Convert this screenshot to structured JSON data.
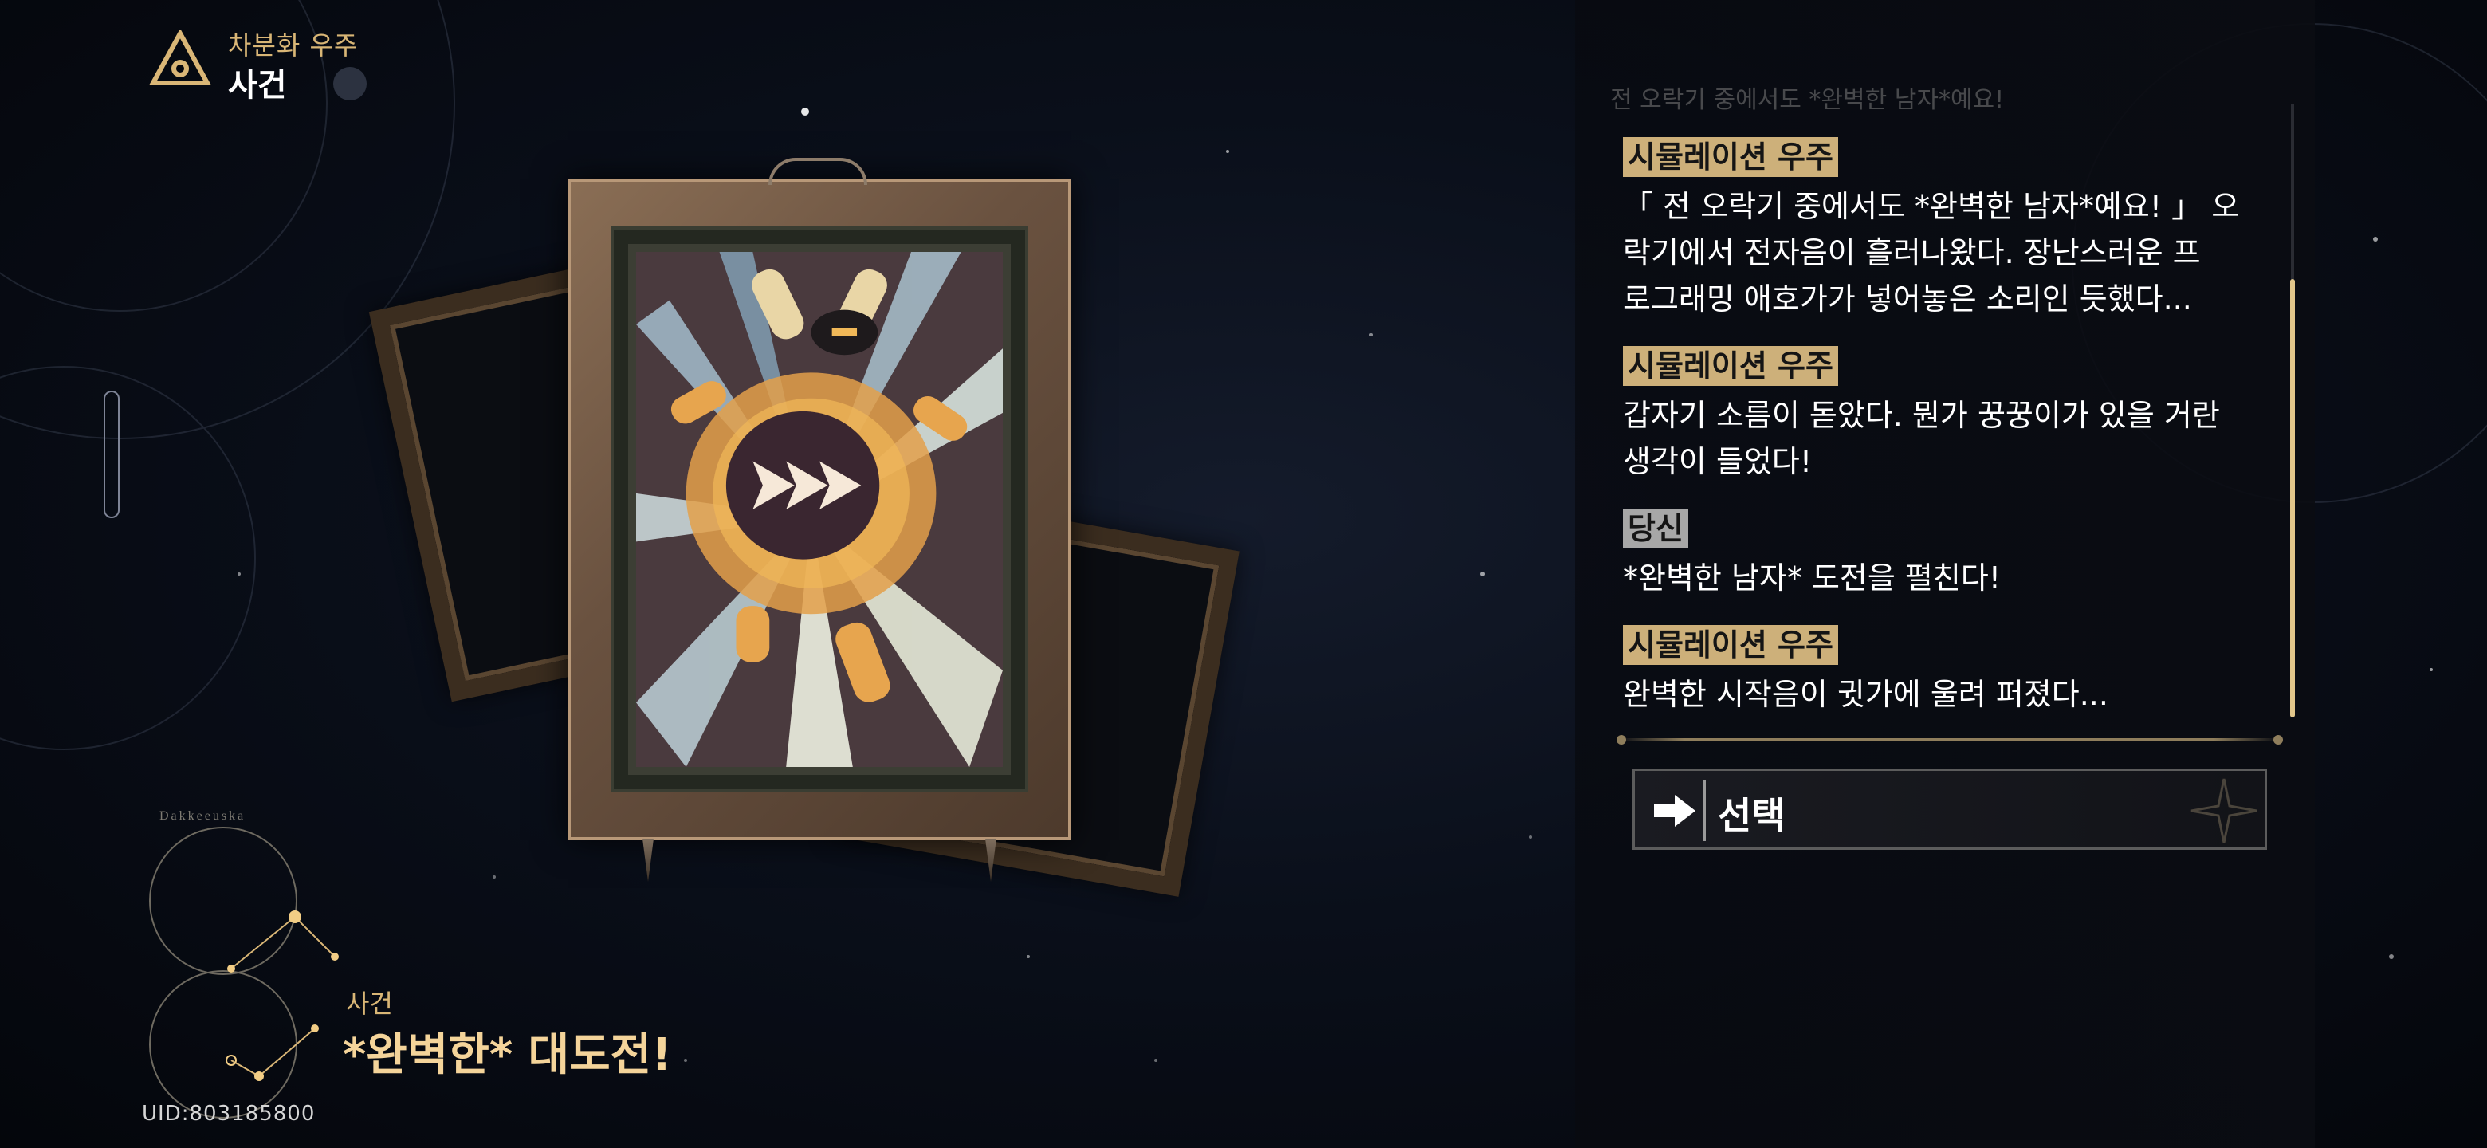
{
  "header": {
    "subtitle": "차분화 우주",
    "title": "사건"
  },
  "event": {
    "category": "사건",
    "title": "*완벽한* 대도전!"
  },
  "uid": "UID:803185800",
  "constellation_label": "Dakkeeuska",
  "dialog": {
    "partial_line": "전 오락기 중에서도 *완벽한 남자*예요!",
    "entries": [
      {
        "speaker": "시뮬레이션 우주",
        "lines": [
          "「 전 오락기 중에서도 *완벽한 남자*예요! 」 오",
          "락기에서 전자음이 흘러나왔다. 장난스러운 프",
          "로그래밍 애호가가 넣어놓은 소리인 듯했다..."
        ]
      },
      {
        "speaker": "시뮬레이션 우주",
        "lines": [
          "갑자기 소름이 돋았다. 뭔가 꿍꿍이가 있을 거란",
          "생각이 들었다!"
        ]
      },
      {
        "speaker": "당신",
        "lines": [
          "*완벽한 남자* 도전을 펼친다!"
        ]
      },
      {
        "speaker": "시뮬레이션 우주",
        "lines": [
          "완벽한 시작음이 귓가에 울려 퍼졌다..."
        ]
      }
    ]
  },
  "choice": {
    "label": "선택",
    "icon": "arrow-right-icon"
  },
  "colors": {
    "gold": "#d9b676",
    "speaker_sim_bg": "#cdb07a",
    "speaker_you_bg": "#a7a7a7",
    "scroll_thumb": "#e2c68a"
  }
}
